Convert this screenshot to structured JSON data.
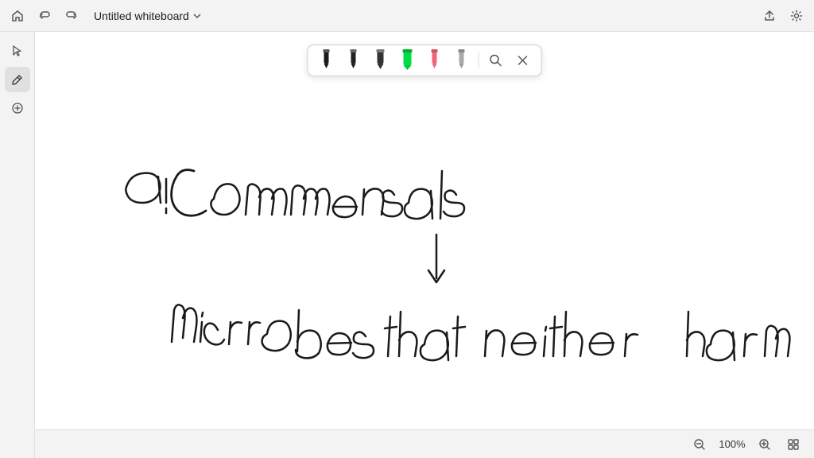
{
  "titlebar": {
    "title": "Untitled whiteboard",
    "home_icon": "⌂",
    "undo_icon": "↩",
    "redo_icon": "↪",
    "chevron_icon": "∨",
    "share_icon": "⬆",
    "settings_icon": "⚙"
  },
  "sidebar": {
    "select_label": "Select",
    "pen_label": "Pen",
    "add_label": "Add"
  },
  "toolbar": {
    "pen1_label": "Black pen",
    "pen2_label": "Dark pen",
    "pen3_label": "Darker pen",
    "pen4_label": "Green highlighter",
    "pen5_label": "Pink pen",
    "pen6_label": "Gray pen",
    "search_label": "Search",
    "close_label": "Close"
  },
  "zoom": {
    "level": "100%",
    "zoom_in": "+",
    "zoom_out": "-",
    "fit_label": "Fit"
  }
}
